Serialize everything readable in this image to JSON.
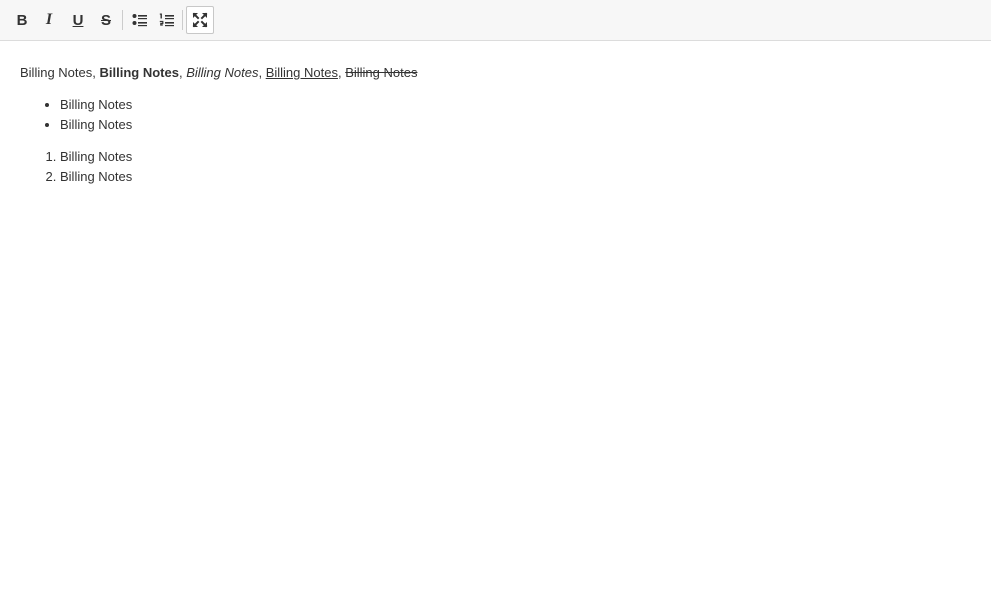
{
  "toolbar": {
    "bold": "B",
    "italic": "I",
    "underline": "U",
    "strike": "S",
    "icons": {
      "bulleted_list": "bulleted-list-icon",
      "numbered_list": "numbered-list-icon",
      "fullscreen": "fullscreen-icon"
    }
  },
  "content": {
    "line": {
      "plain": "Billing Notes",
      "sep1": ", ",
      "bold": "Billing Notes",
      "sep2": ", ",
      "italic": "Billing Notes",
      "sep3": ", ",
      "underline": "Billing Notes",
      "sep4": ", ",
      "strike": "Billing Notes"
    },
    "bullet_items": [
      "Billing Notes",
      "Billing Notes"
    ],
    "numbered_items": [
      "Billing Notes",
      "Billing Notes"
    ]
  }
}
